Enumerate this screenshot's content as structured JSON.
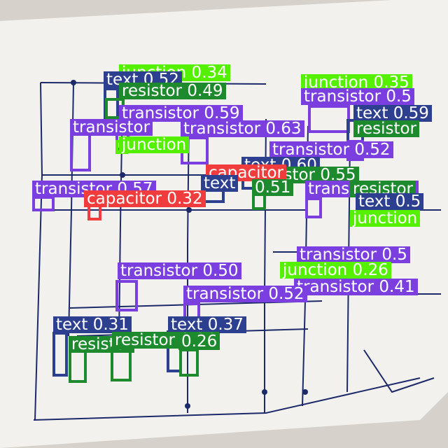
{
  "colors": {
    "transistor": "#7b3fe0",
    "text": "#2d3f8f",
    "resistor": "#1e8a2e",
    "junction": "#55f000",
    "capacitor": "#f03c3c",
    "paper": "#f2f0ec",
    "ink": "#1c2a6a"
  },
  "detections": [
    {
      "class": "junction",
      "label": "junction 0.34"
    },
    {
      "class": "junction",
      "label": "junction 0.35"
    },
    {
      "class": "text",
      "label": "text 0.52"
    },
    {
      "class": "resistor",
      "label": "resistor 0.49"
    },
    {
      "class": "transistor",
      "label": "transistor 0.5"
    },
    {
      "class": "transistor",
      "label": "transistor 0.59"
    },
    {
      "class": "text",
      "label": "text 0.59"
    },
    {
      "class": "transistor",
      "label": "transistor"
    },
    {
      "class": "transistor",
      "label": "transistor 0.63"
    },
    {
      "class": "resistor",
      "label": "resistor"
    },
    {
      "class": "junction",
      "label": "junction"
    },
    {
      "class": "transistor",
      "label": "transistor 0.52"
    },
    {
      "class": "text",
      "label": "text 0.60"
    },
    {
      "class": "resistor",
      "label": "resistor 0.55"
    },
    {
      "class": "capacitor",
      "label": "capacitor"
    },
    {
      "class": "text",
      "label": "text"
    },
    {
      "class": "resistor",
      "label": "0.51"
    },
    {
      "class": "transistor",
      "label": "transistor 0.57"
    },
    {
      "class": "capacitor",
      "label": "capacitor 0.32"
    },
    {
      "class": "transistor",
      "label": "transistor 0.5"
    },
    {
      "class": "resistor",
      "label": "resistor"
    },
    {
      "class": "transistor",
      "label": "transistor 0.5"
    },
    {
      "class": "text",
      "label": "text 0.5"
    },
    {
      "class": "junction",
      "label": "junction"
    },
    {
      "class": "transistor",
      "label": "transistor 0.50"
    },
    {
      "class": "junction",
      "label": "junction 0.26"
    },
    {
      "class": "transistor",
      "label": "transistor 0.41"
    },
    {
      "class": "transistor",
      "label": "transistor 0.52"
    },
    {
      "class": "text",
      "label": "text 0.31"
    },
    {
      "class": "text",
      "label": "text 0.37"
    },
    {
      "class": "resistor",
      "label": "resistor"
    },
    {
      "class": "resistor",
      "label": "resistor 0.36"
    },
    {
      "class": "resistor",
      "label": "0.26"
    }
  ]
}
